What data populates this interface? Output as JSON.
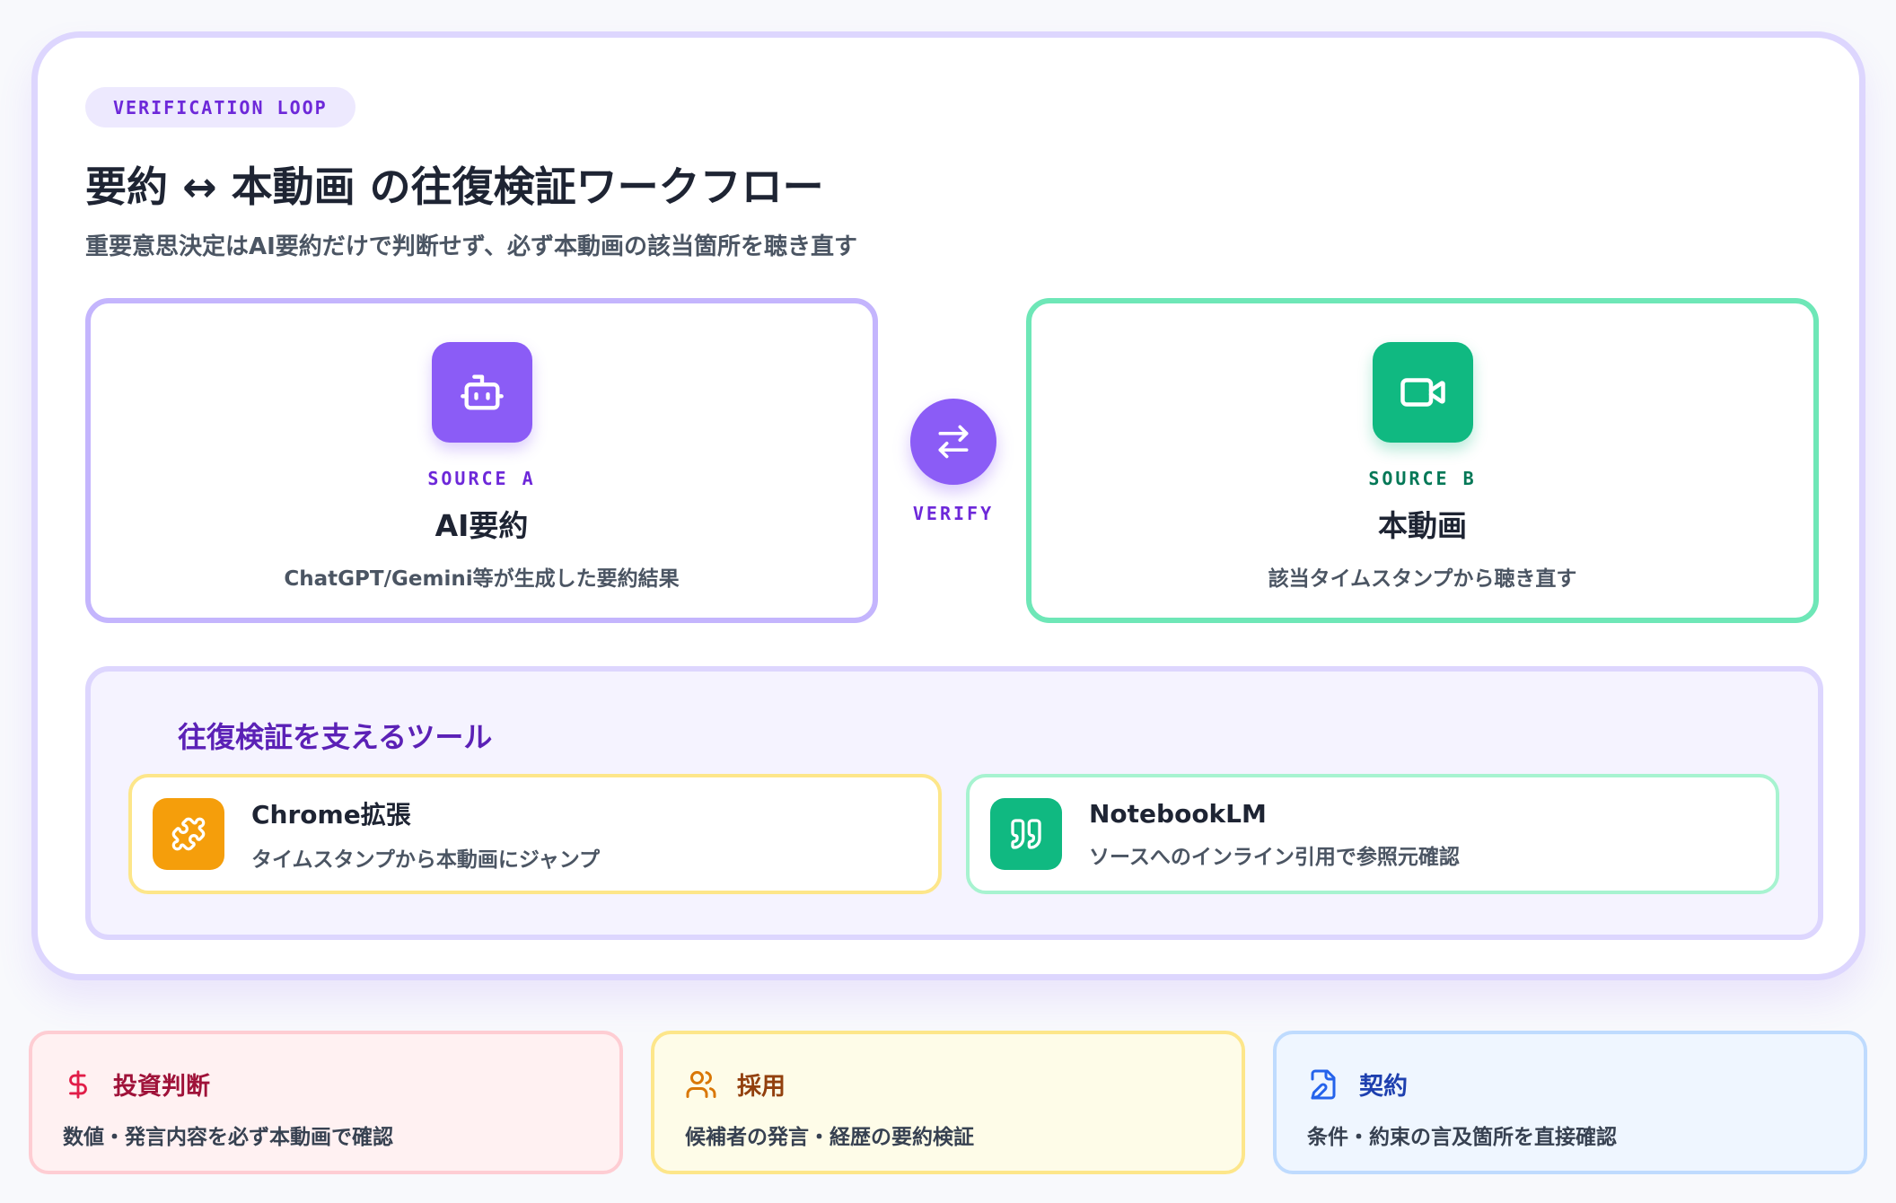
{
  "header": {
    "badge": "VERIFICATION LOOP",
    "title": "要約 ↔ 本動画 の往復検証ワークフロー",
    "subtitle": "重要意思決定はAI要約だけで判断せず、必ず本動画の該当箇所を聴き直す"
  },
  "source_a": {
    "icon": "robot-icon",
    "label": "SOURCE A",
    "title": "AI要約",
    "description": "ChatGPT/Gemini等が生成した要約結果",
    "color": "#8b5cf6"
  },
  "verify": {
    "icon": "swap-arrows-icon",
    "label": "VERIFY"
  },
  "source_b": {
    "icon": "video-camera-icon",
    "label": "SOURCE B",
    "title": "本動画",
    "description": "該当タイムスタンプから聴き直す",
    "color": "#10b981"
  },
  "tools": {
    "title": "往復検証を支えるツール",
    "items": [
      {
        "icon": "puzzle-icon",
        "name": "Chrome拡張",
        "description": "タイムスタンプから本動画にジャンプ",
        "color": "#f59e0b"
      },
      {
        "icon": "quote-icon",
        "name": "NotebookLM",
        "description": "ソースへのインライン引用で参照元確認",
        "color": "#10b981"
      }
    ]
  },
  "use_cases": [
    {
      "icon": "dollar-icon",
      "title": "投資判断",
      "description": "数値・発言内容を必ず本動画で確認",
      "color": "#e11d48"
    },
    {
      "icon": "users-icon",
      "title": "採用",
      "description": "候補者の発言・経歴の要約検証",
      "color": "#d97706"
    },
    {
      "icon": "document-edit-icon",
      "title": "契約",
      "description": "条件・約束の言及箇所を直接確認",
      "color": "#2563eb"
    }
  ]
}
